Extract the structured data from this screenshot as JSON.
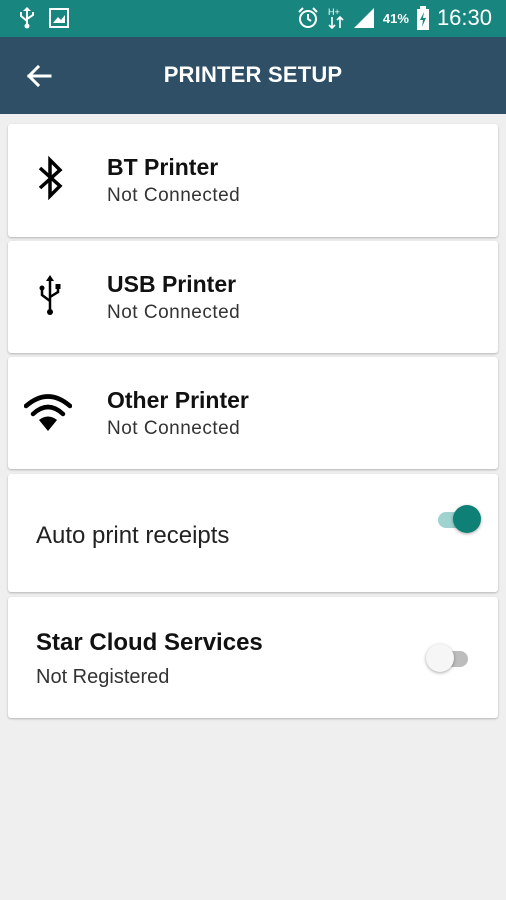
{
  "status_bar": {
    "battery": "41%",
    "time": "16:30",
    "icons": [
      "usb-debug-icon",
      "screenshot-icon",
      "alarm-icon",
      "data-transfer-icon",
      "signal-icon",
      "battery-charging-icon"
    ]
  },
  "app_bar": {
    "title": "PRINTER SETUP",
    "back_icon": "arrow-left-icon",
    "color": "#2e4f66"
  },
  "printers": [
    {
      "name": "BT Printer",
      "status": "Not Connected",
      "icon": "bluetooth-icon"
    },
    {
      "name": "USB Printer",
      "status": "Not Connected",
      "icon": "usb-icon"
    },
    {
      "name": "Other Printer",
      "status": "Not Connected",
      "icon": "wifi-icon"
    }
  ],
  "auto_print": {
    "label": "Auto print receipts",
    "enabled": true
  },
  "star_cloud": {
    "title": "Star Cloud Services",
    "status": "Not Registered",
    "enabled": false
  },
  "colors": {
    "status_bar": "#19857f",
    "accent": "#0e8075",
    "background": "#efefef"
  }
}
